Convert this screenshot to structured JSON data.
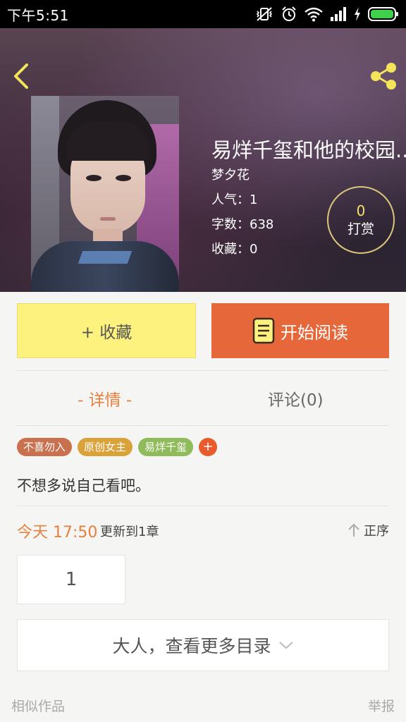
{
  "status_bar": {
    "time": "下午5:51",
    "icons": [
      "vibrate-off-icon",
      "alarm-icon",
      "wifi-icon",
      "signal-icon",
      "charging-icon",
      "battery-icon"
    ]
  },
  "header": {
    "back_icon": "chevron-left-icon",
    "share_icon": "share-icon"
  },
  "book": {
    "title": "易烊千玺和他的校园...",
    "author": "梦夕花",
    "popularity": "人气：1",
    "word_count": "字数：638",
    "favorites": "收藏：0"
  },
  "reward": {
    "count": "0",
    "label": "打赏"
  },
  "actions": {
    "favorite_label": "+ 收藏",
    "read_label": "开始阅读"
  },
  "tabs": [
    {
      "label": "- 详情 -",
      "active": true
    },
    {
      "label": "评论(0)",
      "active": false
    }
  ],
  "tags": [
    {
      "label": "不喜勿入",
      "color": "#c9704f"
    },
    {
      "label": "原创女主",
      "color": "#d9a23a"
    },
    {
      "label": "易烊千玺",
      "color": "#8fbb5a"
    }
  ],
  "tag_add_label": "+",
  "description": "不想多说自己看吧。",
  "update": {
    "time": "今天 17:50",
    "text": "更新到1章",
    "order_label": "正序"
  },
  "chapters": [
    "1"
  ],
  "more_catalog_label": "大人，查看更多目录",
  "footer": {
    "similar_label": "相似作品",
    "report_label": "举报"
  },
  "colors": {
    "accent_orange": "#e6673a",
    "tab_active": "#e6803f",
    "favorite_yellow": "#fdf27e",
    "reward_yellow": "#f5e06a"
  }
}
